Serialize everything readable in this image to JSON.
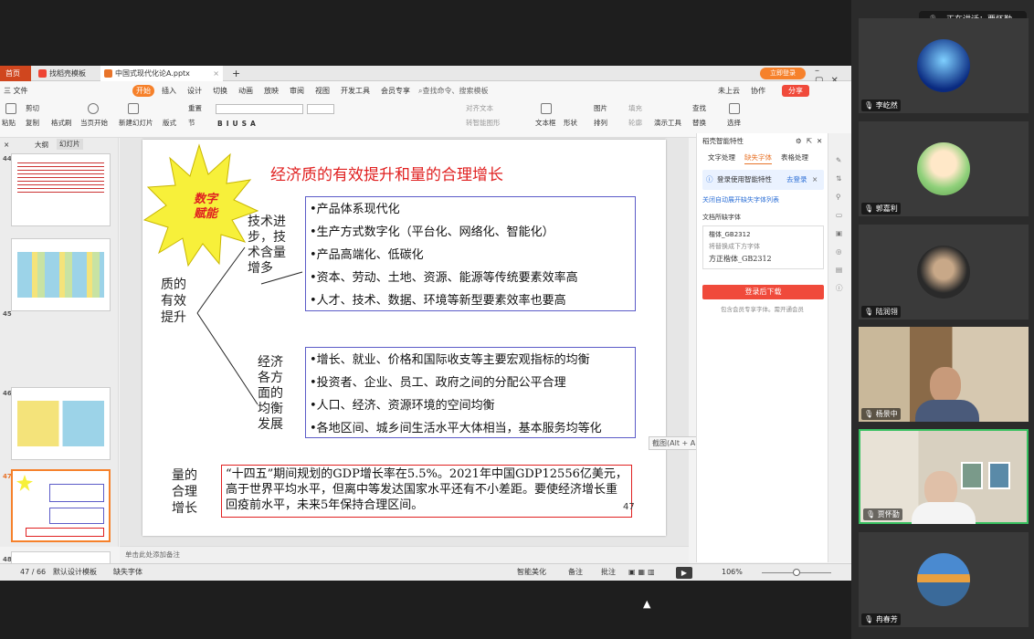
{
  "app": {
    "tabs": [
      {
        "label": "首页",
        "active": true
      },
      {
        "label": "找稻壳模板"
      },
      {
        "label": "中国式现代化论A.pptx",
        "active_file": true
      }
    ],
    "login_btn": "立即登录",
    "menu": [
      "三 文件",
      "开始",
      "插入",
      "设计",
      "切换",
      "动画",
      "放映",
      "审阅",
      "视图",
      "开发工具",
      "会员专享"
    ],
    "search_placeholder": "查找命令、搜索模板",
    "menu_right": [
      "未上云",
      "协作",
      "分享"
    ],
    "ribbon": {
      "paste": "粘贴",
      "cut": "剪切",
      "copy": "复制",
      "format_painter": "格式刷",
      "from_current": "当页开始",
      "new_slide": "新建幻灯片",
      "layout": "版式",
      "section": "节",
      "reset": "重置",
      "align_text": "对齐文本",
      "smartart": "转智能图形",
      "textbox": "文本框",
      "shape": "形状",
      "arrange": "排列",
      "image": "图片",
      "fill": "填充",
      "outline": "轮廓",
      "play": "演示工具",
      "replace": "替换",
      "find": "查找",
      "select": "选择"
    },
    "thumb_tabs": [
      "大纲",
      "幻灯片"
    ],
    "thumbs": [
      {
        "num": "44"
      },
      {
        "num": "45"
      },
      {
        "num": "46"
      },
      {
        "num": "47",
        "active": true
      },
      {
        "num": "48"
      }
    ],
    "slide": {
      "star_text": "数字\n赋能",
      "title": "经济质的有效提升和量的合理增长",
      "left_label": "质的\n有效\n提升",
      "tech_label": "技术进\n步，技\n术含量\n增多",
      "box1": [
        "•产品体系现代化",
        "•生产方式数字化（平台化、网络化、智能化）",
        "•产品高端化、低碳化",
        "•资本、劳动、土地、资源、能源等传统要素效率高",
        "•人才、技术、数据、环境等新型要素效率也要高"
      ],
      "balance_label": "经济\n各方\n面的\n均衡\n发展",
      "box2": [
        "•增长、就业、价格和国际收支等主要宏观指标的均衡",
        "•投资者、企业、员工、政府之间的分配公平合理",
        "•人口、经济、资源环境的空间均衡",
        "•各地区间、城乡间生活水平大体相当，基本服务均等化"
      ],
      "quantity_label": "量的\n合理\n增长",
      "box3": "“十四五”期间规划的GDP增长率在5.5%。2021年中国GDP12556亿美元，高于世界平均水平，但离中等发达国家水平还有不小差距。要使经济增长重回疫前水平，未来5年保持合理区间。",
      "page_num": "47",
      "tooltip": "截图(Alt + A)"
    },
    "side": {
      "header": "稻壳智能特性",
      "tabs": [
        "文字处理",
        "缺失字体",
        "表格处理"
      ],
      "login_tip": "登录使用智能特性",
      "login_link": "去登录",
      "font_link": "关闭自动展开缺失字体列表",
      "missing_title": "文档所缺字体",
      "font1": "楷体_GB2312",
      "font_hint": "将替换成下方字体",
      "font2": "方正楷体_GB2312",
      "download_btn": "登录后下载",
      "vip_tip": "包含会员专享字体。需开通会员"
    },
    "notes": "单击此处添加备注",
    "status": {
      "page": "47 / 66",
      "template": "默认设计模板",
      "missing_font": "缺失字体",
      "beautify": "智能美化",
      "notes": "备注",
      "comment": "批注",
      "zoom": "106%"
    }
  },
  "meeting": {
    "speaking": "正在讲话：贾怀勤",
    "participants": [
      {
        "name": "李屹然"
      },
      {
        "name": "郭嘉利"
      },
      {
        "name": "陆润翎"
      },
      {
        "name": "杨景中"
      },
      {
        "name": "贾怀勤",
        "active": true
      },
      {
        "name": "冉春芳"
      }
    ]
  },
  "colors": {
    "accent": "#f6812b",
    "title_red": "#e02020",
    "box_blue": "#5b5bc8",
    "red_btn": "#f04a3b"
  }
}
